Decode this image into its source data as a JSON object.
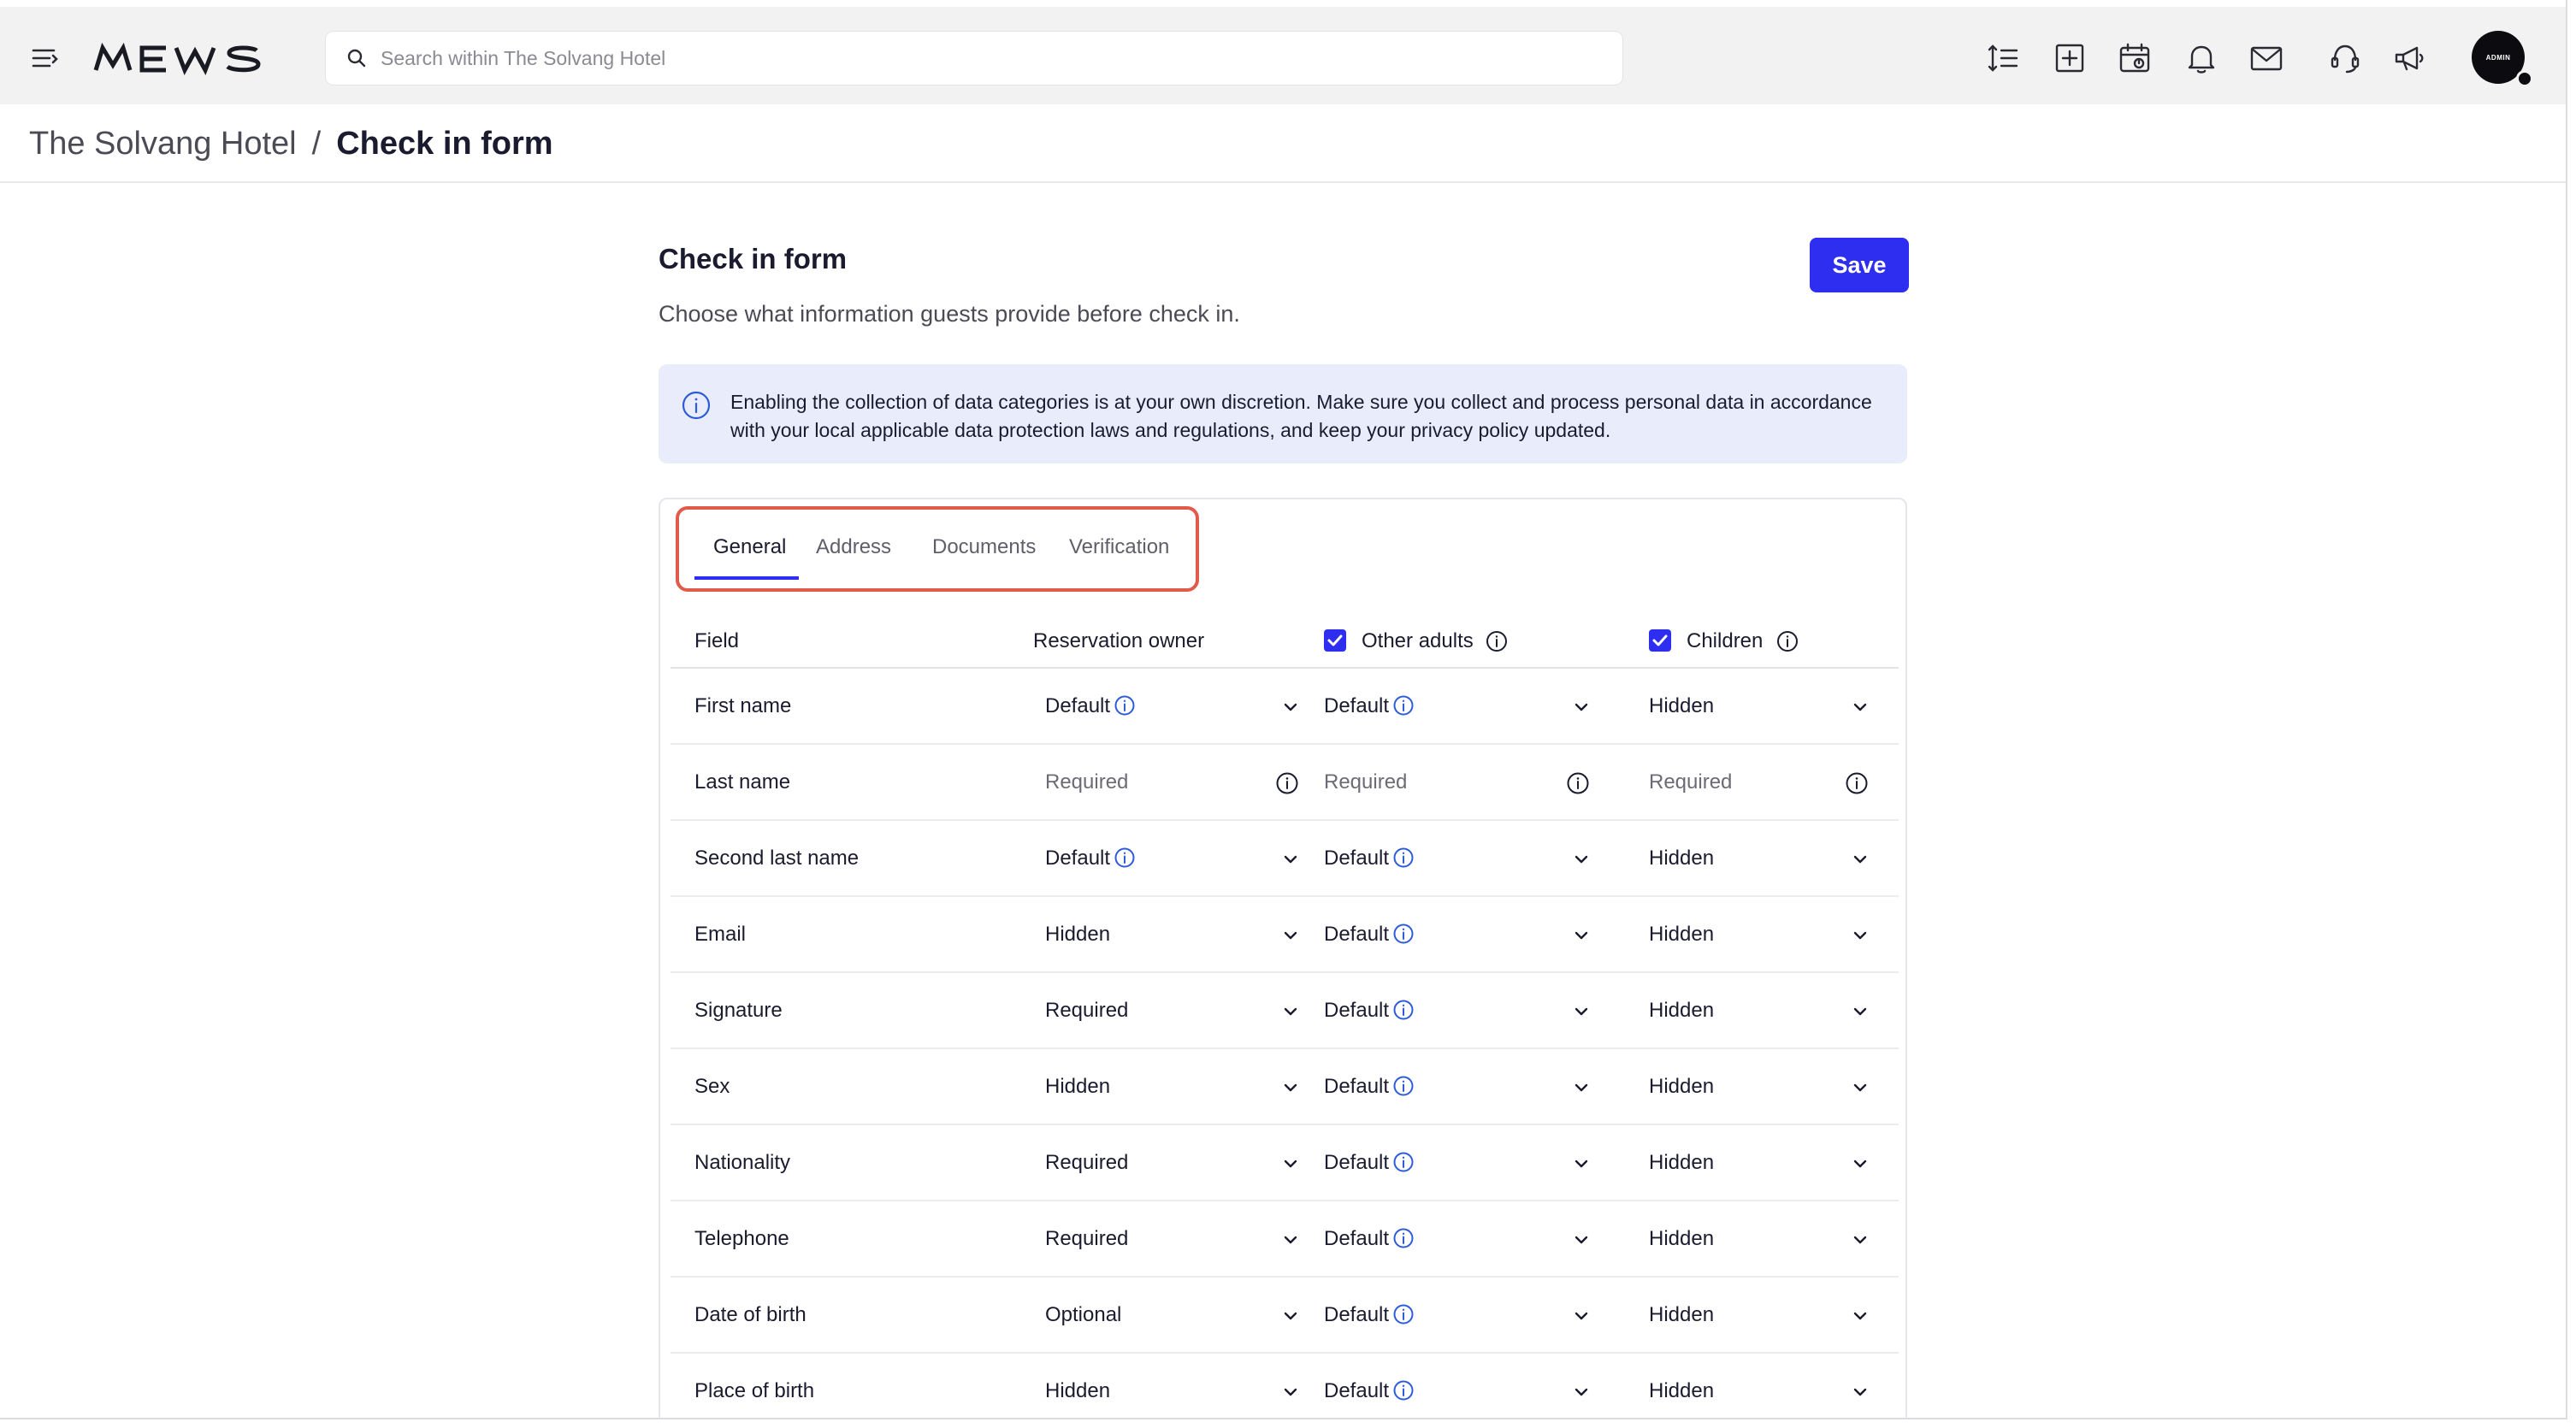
{
  "app": {
    "logo_text": "MEWS",
    "search_placeholder": "Search within The Solvang Hotel",
    "avatar_label": "ADMIN"
  },
  "breadcrumb": {
    "parent": "The Solvang Hotel",
    "separator": "/",
    "current": "Check in form"
  },
  "page": {
    "title": "Check in form",
    "subtitle": "Choose what information guests provide before check in.",
    "save_label": "Save",
    "alert_text": "Enabling the collection of data categories is at your own discretion. Make sure you collect and process personal data in accordance with your local applicable data protection laws and regulations, and keep your privacy policy updated."
  },
  "tabs": [
    {
      "label": "General",
      "active": true
    },
    {
      "label": "Address",
      "active": false
    },
    {
      "label": "Documents",
      "active": false
    },
    {
      "label": "Verification",
      "active": false
    }
  ],
  "table": {
    "headers": {
      "field": "Field",
      "owner": "Reservation owner",
      "adults": "Other adults",
      "children": "Children"
    },
    "adults_checked": true,
    "children_checked": true,
    "rows": [
      {
        "field": "First name",
        "owner": "Default",
        "adults": "Default",
        "children": "Hidden"
      },
      {
        "field": "Last name",
        "owner": "Required",
        "adults": "Required",
        "children": "Required"
      },
      {
        "field": "Second last name",
        "owner": "Default",
        "adults": "Default",
        "children": "Hidden"
      },
      {
        "field": "Email",
        "owner": "Hidden",
        "adults": "Default",
        "children": "Hidden"
      },
      {
        "field": "Signature",
        "owner": "Required",
        "adults": "Default",
        "children": "Hidden"
      },
      {
        "field": "Sex",
        "owner": "Hidden",
        "adults": "Default",
        "children": "Hidden"
      },
      {
        "field": "Nationality",
        "owner": "Required",
        "adults": "Default",
        "children": "Hidden"
      },
      {
        "field": "Telephone",
        "owner": "Required",
        "adults": "Default",
        "children": "Hidden"
      },
      {
        "field": "Date of birth",
        "owner": "Optional",
        "adults": "Default",
        "children": "Hidden"
      },
      {
        "field": "Place of birth",
        "owner": "Hidden",
        "adults": "Default",
        "children": "Hidden"
      }
    ]
  },
  "colors": {
    "accent": "#2e2ef0",
    "highlight": "#e25a4a",
    "alert_bg": "#e9edfb"
  },
  "icons": {
    "menu": "hamburger-menu-icon",
    "search": "search-icon",
    "toolbar": [
      "sort-lines-icon",
      "add-square-icon",
      "calendar-icon",
      "bell-icon",
      "mail-icon",
      "support-icon",
      "announcement-icon"
    ]
  }
}
